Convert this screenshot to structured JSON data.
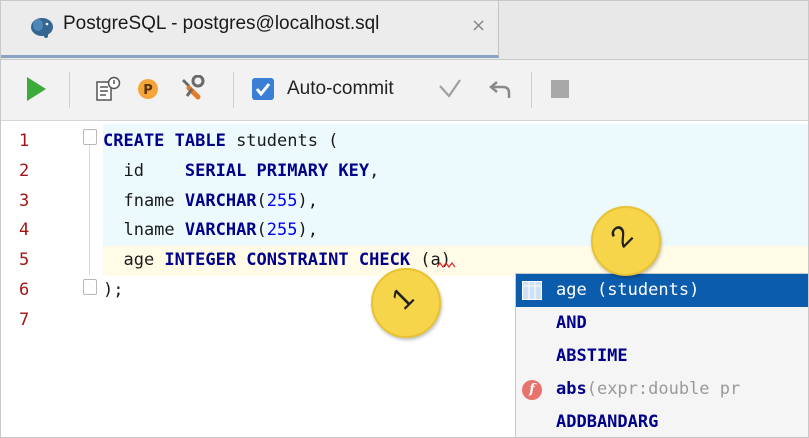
{
  "tab": {
    "title": "PostgreSQL - postgres@localhost.sql",
    "close": "×"
  },
  "toolbar": {
    "autocommit_label": "Auto-commit",
    "autocommit_checked": true
  },
  "editor": {
    "line_numbers": [
      "1",
      "2",
      "3",
      "4",
      "5",
      "6",
      "7"
    ],
    "lines": [
      {
        "segments": [
          [
            "kw",
            "CREATE TABLE "
          ],
          [
            "id",
            "students ("
          ]
        ]
      },
      {
        "segments": [
          [
            "id",
            "  id    "
          ],
          [
            "kw",
            "SERIAL PRIMARY KEY"
          ],
          [
            "id",
            ","
          ]
        ]
      },
      {
        "segments": [
          [
            "id",
            "  fname "
          ],
          [
            "kw",
            "VARCHAR"
          ],
          [
            "id",
            "("
          ],
          [
            "num",
            "255"
          ],
          [
            "id",
            "),"
          ]
        ]
      },
      {
        "segments": [
          [
            "id",
            "  lname "
          ],
          [
            "kw",
            "VARCHAR"
          ],
          [
            "id",
            "("
          ],
          [
            "num",
            "255"
          ],
          [
            "id",
            "),"
          ]
        ]
      },
      {
        "segments": [
          [
            "id",
            "  age "
          ],
          [
            "kw",
            "INTEGER CONSTRAINT CHECK "
          ],
          [
            "id",
            "(a)"
          ]
        ]
      },
      {
        "segments": [
          [
            "id",
            ");"
          ]
        ]
      },
      {
        "segments": []
      }
    ]
  },
  "autocomplete": {
    "items": [
      {
        "icon": "table-icon",
        "main": "age",
        "extra": " (students)"
      },
      {
        "icon": "",
        "main": "AND",
        "extra": ""
      },
      {
        "icon": "",
        "main": "ABSTIME",
        "extra": ""
      },
      {
        "icon": "function-icon",
        "main": "abs",
        "extra": "(expr:double pr",
        "icon_text": "f"
      },
      {
        "icon": "",
        "main": "ADDBANDARG",
        "extra": ""
      }
    ]
  },
  "callouts": [
    "1",
    "2"
  ],
  "colors": {
    "run": "#3bab3b",
    "checkbox": "#3a7fd5",
    "selection": "#0b5cad",
    "callout": "#f7d54a",
    "keyword": "#00008b",
    "line_number": "#a31515"
  }
}
